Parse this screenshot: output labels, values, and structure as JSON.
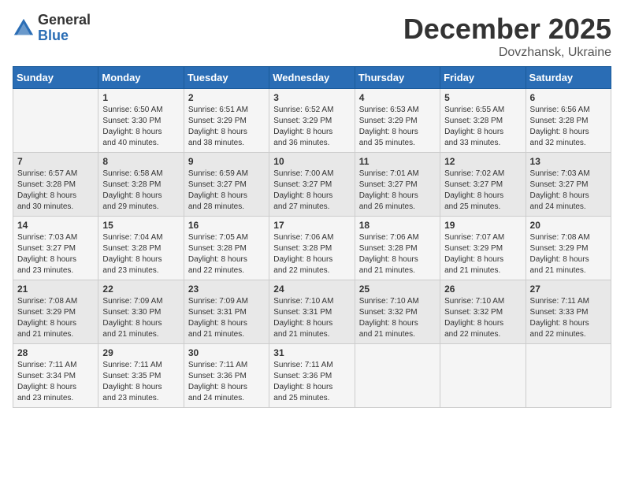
{
  "logo": {
    "general": "General",
    "blue": "Blue"
  },
  "header": {
    "month": "December 2025",
    "location": "Dovzhansk, Ukraine"
  },
  "days_of_week": [
    "Sunday",
    "Monday",
    "Tuesday",
    "Wednesday",
    "Thursday",
    "Friday",
    "Saturday"
  ],
  "weeks": [
    [
      {
        "day": "",
        "details": ""
      },
      {
        "day": "1",
        "details": "Sunrise: 6:50 AM\nSunset: 3:30 PM\nDaylight: 8 hours\nand 40 minutes."
      },
      {
        "day": "2",
        "details": "Sunrise: 6:51 AM\nSunset: 3:29 PM\nDaylight: 8 hours\nand 38 minutes."
      },
      {
        "day": "3",
        "details": "Sunrise: 6:52 AM\nSunset: 3:29 PM\nDaylight: 8 hours\nand 36 minutes."
      },
      {
        "day": "4",
        "details": "Sunrise: 6:53 AM\nSunset: 3:29 PM\nDaylight: 8 hours\nand 35 minutes."
      },
      {
        "day": "5",
        "details": "Sunrise: 6:55 AM\nSunset: 3:28 PM\nDaylight: 8 hours\nand 33 minutes."
      },
      {
        "day": "6",
        "details": "Sunrise: 6:56 AM\nSunset: 3:28 PM\nDaylight: 8 hours\nand 32 minutes."
      }
    ],
    [
      {
        "day": "7",
        "details": "Sunrise: 6:57 AM\nSunset: 3:28 PM\nDaylight: 8 hours\nand 30 minutes."
      },
      {
        "day": "8",
        "details": "Sunrise: 6:58 AM\nSunset: 3:28 PM\nDaylight: 8 hours\nand 29 minutes."
      },
      {
        "day": "9",
        "details": "Sunrise: 6:59 AM\nSunset: 3:27 PM\nDaylight: 8 hours\nand 28 minutes."
      },
      {
        "day": "10",
        "details": "Sunrise: 7:00 AM\nSunset: 3:27 PM\nDaylight: 8 hours\nand 27 minutes."
      },
      {
        "day": "11",
        "details": "Sunrise: 7:01 AM\nSunset: 3:27 PM\nDaylight: 8 hours\nand 26 minutes."
      },
      {
        "day": "12",
        "details": "Sunrise: 7:02 AM\nSunset: 3:27 PM\nDaylight: 8 hours\nand 25 minutes."
      },
      {
        "day": "13",
        "details": "Sunrise: 7:03 AM\nSunset: 3:27 PM\nDaylight: 8 hours\nand 24 minutes."
      }
    ],
    [
      {
        "day": "14",
        "details": "Sunrise: 7:03 AM\nSunset: 3:27 PM\nDaylight: 8 hours\nand 23 minutes."
      },
      {
        "day": "15",
        "details": "Sunrise: 7:04 AM\nSunset: 3:28 PM\nDaylight: 8 hours\nand 23 minutes."
      },
      {
        "day": "16",
        "details": "Sunrise: 7:05 AM\nSunset: 3:28 PM\nDaylight: 8 hours\nand 22 minutes."
      },
      {
        "day": "17",
        "details": "Sunrise: 7:06 AM\nSunset: 3:28 PM\nDaylight: 8 hours\nand 22 minutes."
      },
      {
        "day": "18",
        "details": "Sunrise: 7:06 AM\nSunset: 3:28 PM\nDaylight: 8 hours\nand 21 minutes."
      },
      {
        "day": "19",
        "details": "Sunrise: 7:07 AM\nSunset: 3:29 PM\nDaylight: 8 hours\nand 21 minutes."
      },
      {
        "day": "20",
        "details": "Sunrise: 7:08 AM\nSunset: 3:29 PM\nDaylight: 8 hours\nand 21 minutes."
      }
    ],
    [
      {
        "day": "21",
        "details": "Sunrise: 7:08 AM\nSunset: 3:29 PM\nDaylight: 8 hours\nand 21 minutes."
      },
      {
        "day": "22",
        "details": "Sunrise: 7:09 AM\nSunset: 3:30 PM\nDaylight: 8 hours\nand 21 minutes."
      },
      {
        "day": "23",
        "details": "Sunrise: 7:09 AM\nSunset: 3:31 PM\nDaylight: 8 hours\nand 21 minutes."
      },
      {
        "day": "24",
        "details": "Sunrise: 7:10 AM\nSunset: 3:31 PM\nDaylight: 8 hours\nand 21 minutes."
      },
      {
        "day": "25",
        "details": "Sunrise: 7:10 AM\nSunset: 3:32 PM\nDaylight: 8 hours\nand 21 minutes."
      },
      {
        "day": "26",
        "details": "Sunrise: 7:10 AM\nSunset: 3:32 PM\nDaylight: 8 hours\nand 22 minutes."
      },
      {
        "day": "27",
        "details": "Sunrise: 7:11 AM\nSunset: 3:33 PM\nDaylight: 8 hours\nand 22 minutes."
      }
    ],
    [
      {
        "day": "28",
        "details": "Sunrise: 7:11 AM\nSunset: 3:34 PM\nDaylight: 8 hours\nand 23 minutes."
      },
      {
        "day": "29",
        "details": "Sunrise: 7:11 AM\nSunset: 3:35 PM\nDaylight: 8 hours\nand 23 minutes."
      },
      {
        "day": "30",
        "details": "Sunrise: 7:11 AM\nSunset: 3:36 PM\nDaylight: 8 hours\nand 24 minutes."
      },
      {
        "day": "31",
        "details": "Sunrise: 7:11 AM\nSunset: 3:36 PM\nDaylight: 8 hours\nand 25 minutes."
      },
      {
        "day": "",
        "details": ""
      },
      {
        "day": "",
        "details": ""
      },
      {
        "day": "",
        "details": ""
      }
    ]
  ]
}
